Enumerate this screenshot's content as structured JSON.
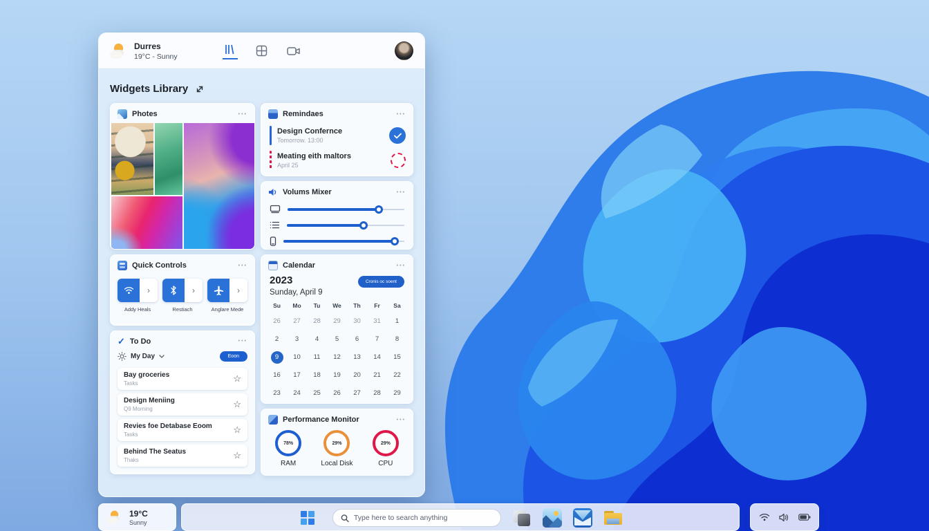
{
  "panel": {
    "title": "Widgets Library",
    "header": {
      "location": "Durres",
      "weather": "19°C - Sunny",
      "tabs": [
        "widgets-library",
        "widgets-grid",
        "capture"
      ]
    }
  },
  "widgets": {
    "photos": {
      "title": "Photes",
      "menu": "•••"
    },
    "reminders": {
      "title": "Remindaes",
      "menu": "•••",
      "items": [
        {
          "title": "Design Confernce",
          "time": "Tomorrow. 13:00",
          "accent": "#2a62d8",
          "state": "done"
        },
        {
          "title": "Meating eith maltors",
          "time": "April 25",
          "accent": "#e0184a",
          "state": "open"
        }
      ]
    },
    "volume_mixer": {
      "title": "Volums Mixer",
      "menu": "•••",
      "sliders": [
        {
          "device": "display",
          "value": 78
        },
        {
          "device": "apps",
          "value": 65
        },
        {
          "device": "phone",
          "value": 92
        }
      ],
      "accent": "#1e5fd0"
    },
    "quick_controls": {
      "title": "Quick Controls",
      "menu": "•••",
      "controls": [
        {
          "label": "Addy Heals",
          "icon": "wifi"
        },
        {
          "label": "Restiach",
          "icon": "bluetooth"
        },
        {
          "label": "Anglare Mede",
          "icon": "airplane"
        }
      ]
    },
    "todo": {
      "title": "To Do",
      "menu": "•••",
      "list_name": "My Day",
      "button": "Eoon",
      "tasks": [
        {
          "title": "Bay groceries",
          "subtitle": "Tasks"
        },
        {
          "title": "Design Meniing",
          "subtitle": "Q9 Morning"
        },
        {
          "title": "Revies foe Detabase Eoom",
          "subtitle": "Tasks"
        },
        {
          "title": "Behind The Seatus",
          "subtitle": "Thaks"
        }
      ]
    },
    "calendar": {
      "title": "Calendar",
      "menu": "•••",
      "year": "2023",
      "date": "Sunday, April 9",
      "button": "Cronis oc soent",
      "day_headers": [
        "Su",
        "Mo",
        "Tu",
        "We",
        "Th",
        "Fr",
        "Sa"
      ],
      "weeks": [
        [
          "26",
          "27",
          "28",
          "29",
          "30",
          "31",
          "1"
        ],
        [
          "2",
          "3",
          "4",
          "5",
          "6",
          "7",
          "8"
        ],
        [
          "9",
          "10",
          "11",
          "12",
          "13",
          "14",
          "15"
        ],
        [
          "16",
          "17",
          "18",
          "19",
          "20",
          "21",
          "22"
        ],
        [
          "23",
          "24",
          "25",
          "26",
          "27",
          "28",
          "29"
        ]
      ],
      "selected_day": "9"
    },
    "performance": {
      "title": "Performance Monitor",
      "menu": "•••",
      "gauges": [
        {
          "label": "RAM",
          "value": "78%",
          "color": "#1d5ed0"
        },
        {
          "label": "Local Disk",
          "value": "29%",
          "color": "#e8913a"
        },
        {
          "label": "CPU",
          "value": "29%",
          "color": "#e0184a"
        }
      ]
    }
  },
  "taskbar": {
    "weather": {
      "temp": "19°C",
      "condition": "Sunny"
    },
    "search_placeholder": "Type here to search anything",
    "apps": [
      "layers",
      "photos",
      "mail",
      "file-explorer"
    ],
    "tray": [
      "wifi",
      "volume",
      "battery"
    ]
  },
  "colors": {
    "accent_blue": "#1e5fd0",
    "selected_day": "#2466c8",
    "reminder_done": "#2a72d8",
    "reminder_open": "#e0184a"
  }
}
